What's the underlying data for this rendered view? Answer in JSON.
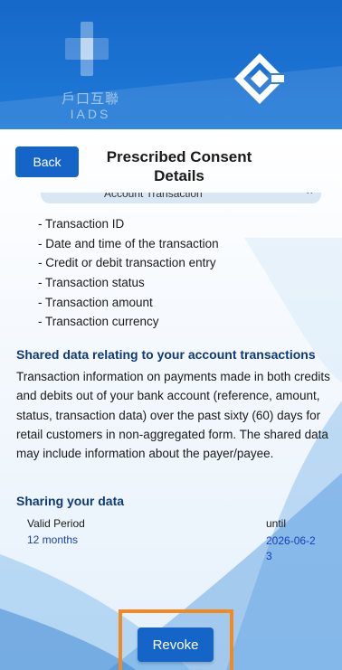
{
  "header": {
    "iads_cjk": "戶口互聯",
    "iads_latin": "IADS"
  },
  "nav": {
    "back_label": "Back",
    "title": "Prescribed Consent Details"
  },
  "collapsed_section": {
    "label": "Account Transaction",
    "toggle_symbol": "^"
  },
  "data_fields": [
    "- Transaction ID",
    "- Date and time of the transaction",
    "- Credit or debit transaction entry",
    "- Transaction status",
    "- Transaction amount",
    "- Transaction currency"
  ],
  "shared_data": {
    "heading": "Shared data relating to your account transactions",
    "description": "Transaction information on payments made in both credits and debits out of your bank account (reference, amount, status, transaction data) over the past sixty (60) days for retail customers in non-aggregated form. The shared data may include information about the payer/payee."
  },
  "sharing": {
    "heading": "Sharing your data",
    "valid_period_label": "Valid Period",
    "valid_period_value": "12 months",
    "until_label": "until",
    "until_value": "2026-06-23"
  },
  "actions": {
    "revoke_label": "Revoke"
  },
  "colors": {
    "header_blue": "#1668c9",
    "button_blue": "#1565c8",
    "heading_navy": "#0d3a78",
    "value_blue": "#1a3fb5",
    "highlight_orange": "#f08a24"
  }
}
